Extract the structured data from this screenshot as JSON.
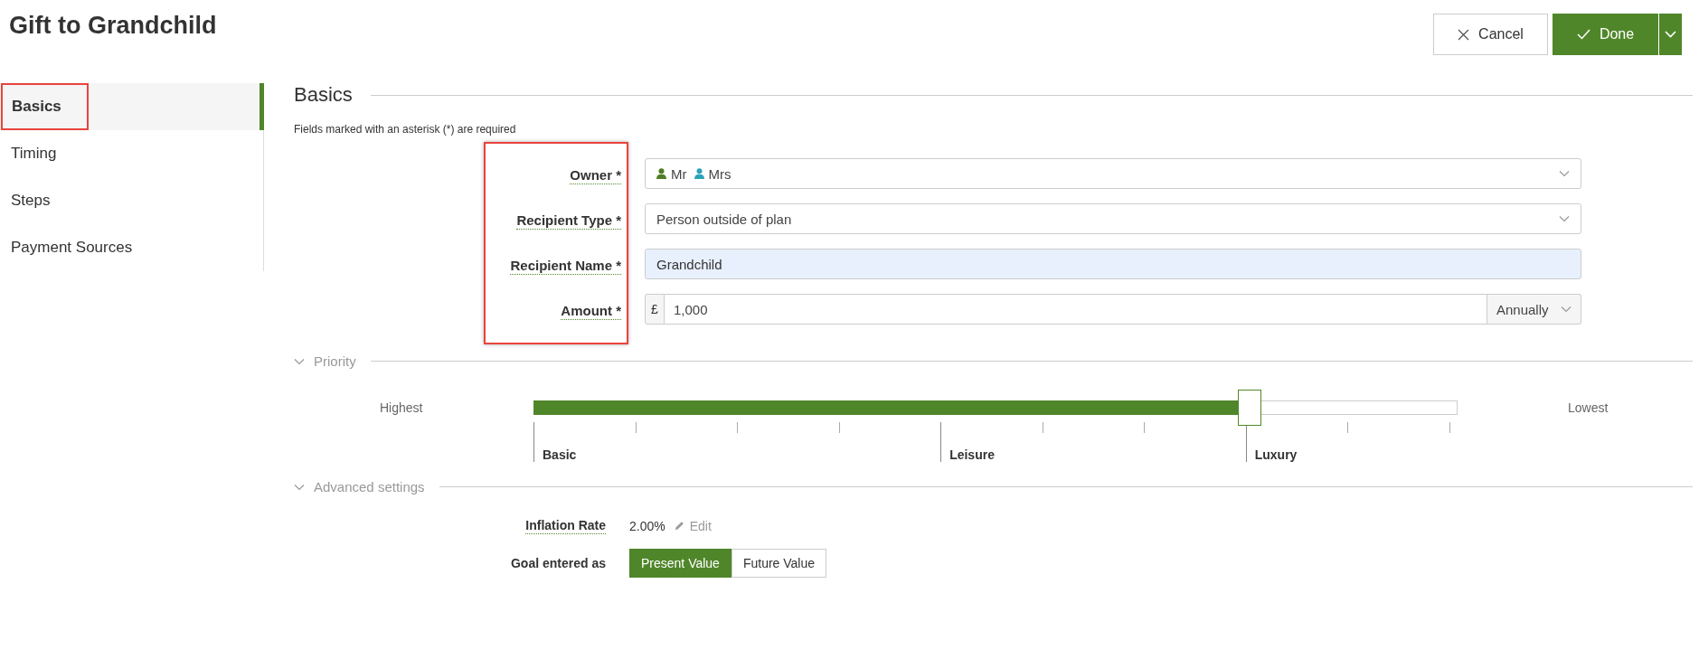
{
  "title": "Gift to Grandchild",
  "actions": {
    "cancel": "Cancel",
    "done": "Done"
  },
  "sidebar": {
    "items": [
      {
        "label": "Basics",
        "selected": true,
        "annotated": true
      },
      {
        "label": "Timing",
        "selected": false,
        "annotated": false
      },
      {
        "label": "Steps",
        "selected": false,
        "annotated": false
      },
      {
        "label": "Payment Sources",
        "selected": false,
        "annotated": false
      }
    ]
  },
  "basics": {
    "heading": "Basics",
    "note": "Fields marked with an asterisk (*) are required",
    "annotated": true,
    "fields": [
      {
        "kind": "owners",
        "label": "Owner *",
        "owners": [
          {
            "name": "Mr",
            "color": "#4e7d23"
          },
          {
            "name": "Mrs",
            "color": "#2aa3b8"
          }
        ]
      },
      {
        "kind": "select",
        "label": "Recipient Type *",
        "value": "Person outside of plan"
      },
      {
        "kind": "text",
        "label": "Recipient Name *",
        "value": "Grandchild"
      },
      {
        "kind": "amount",
        "label": "Amount *",
        "currency": "£",
        "value": "1,000",
        "frequency": "Annually"
      }
    ]
  },
  "priority": {
    "heading": "Priority",
    "expanded": true,
    "low_label": "Highest",
    "high_label": "Lowest",
    "level": 0.775,
    "marks": [
      {
        "kind": "major",
        "label": "Basic"
      },
      {
        "kind": "minor"
      },
      {
        "kind": "minor"
      },
      {
        "kind": "minor"
      },
      {
        "kind": "major",
        "label": "Leisure"
      },
      {
        "kind": "minor"
      },
      {
        "kind": "minor"
      },
      {
        "kind": "major",
        "label": "Luxury"
      },
      {
        "kind": "minor"
      },
      {
        "kind": "minor"
      }
    ]
  },
  "advanced": {
    "heading": "Advanced settings",
    "expanded": true,
    "inflation": {
      "label": "Inflation Rate",
      "value": "2.00%",
      "edit": "Edit"
    },
    "goal": {
      "label": "Goal entered as",
      "options": [
        {
          "label": "Present Value",
          "selected": true
        },
        {
          "label": "Future Value",
          "selected": false
        }
      ]
    }
  }
}
